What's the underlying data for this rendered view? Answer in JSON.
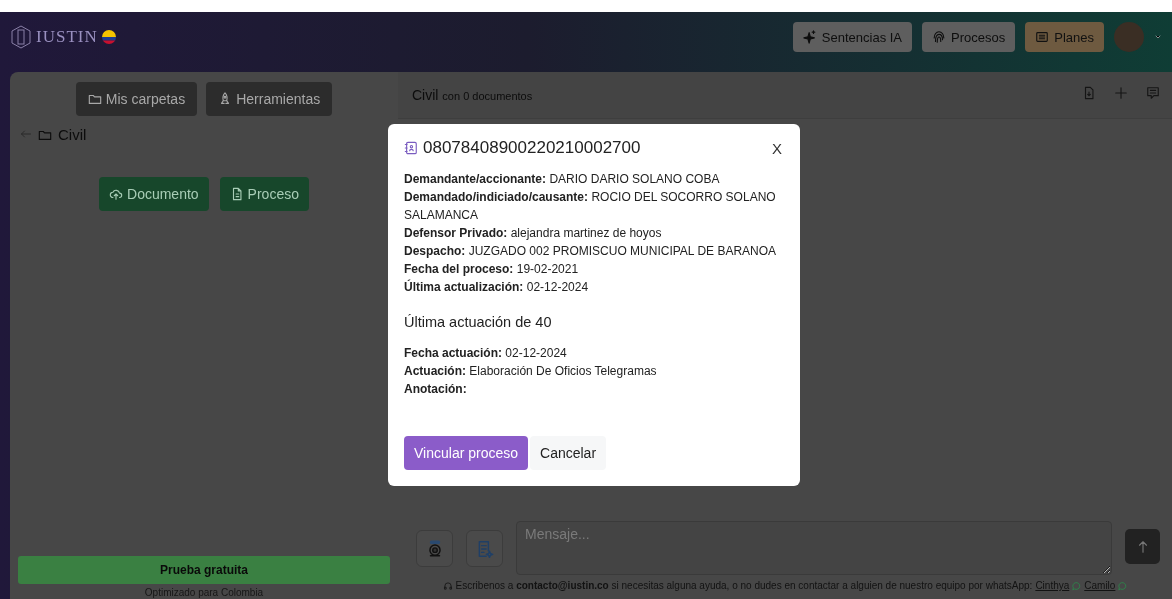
{
  "header": {
    "logo": "IUSTIN",
    "buttons": [
      {
        "label": "Sentencias IA",
        "kind": "sparkle"
      },
      {
        "label": "Procesos",
        "kind": "fingerprint"
      },
      {
        "label": "Planes",
        "kind": "plans"
      }
    ]
  },
  "sidebar": {
    "tabs": [
      {
        "label": "Mis carpetas",
        "kind": "folder"
      },
      {
        "label": "Herramientas",
        "kind": "rocket"
      }
    ],
    "folder": "Civil",
    "actions": [
      {
        "label": "Documento",
        "kind": "upload"
      },
      {
        "label": "Proceso",
        "kind": "file"
      }
    ],
    "trial": "Prueba gratuita",
    "note": "Optimizado para Colombia"
  },
  "main": {
    "title": "Civil",
    "subtitle": "con 0 documentos",
    "message_placeholder": "Mensaje...",
    "footer": "Escribenos a **contacto@iustin.co** si necesitas alguna ayuda, o no dudes en contactar a alguien de nuestro equipo por whatsApp:",
    "contacts": [
      "Cinthya",
      "Camilo"
    ]
  },
  "modal": {
    "title": "08078408900220210002700",
    "close": "X",
    "fields": [
      {
        "label": "Demandante/accionante:",
        "value": "DARIO DARIO SOLANO COBA"
      },
      {
        "label": "Demandado/indiciado/causante:",
        "value": "ROCIO DEL SOCORRO SOLANO SALAMANCA"
      },
      {
        "label": "Defensor Privado:",
        "value": "alejandra martinez de hoyos"
      },
      {
        "label": "Despacho:",
        "value": "JUZGADO 002 PROMISCUO MUNICIPAL DE BARANOA"
      },
      {
        "label": "Fecha del proceso:",
        "value": "19-02-2021"
      },
      {
        "label": "Última actualización:",
        "value": "02-12-2024"
      }
    ],
    "section_title": "Última actuación de 40",
    "action_fields": [
      {
        "label": "Fecha actuación:",
        "value": "02-12-2024"
      },
      {
        "label": "Actuación:",
        "value": "Elaboración De Oficios Telegramas"
      },
      {
        "label": "Anotación:"
      }
    ],
    "buttons": [
      {
        "label": "Vincular proceso",
        "kind": "primary"
      },
      {
        "label": "Cancelar",
        "kind": "secondary"
      }
    ]
  }
}
